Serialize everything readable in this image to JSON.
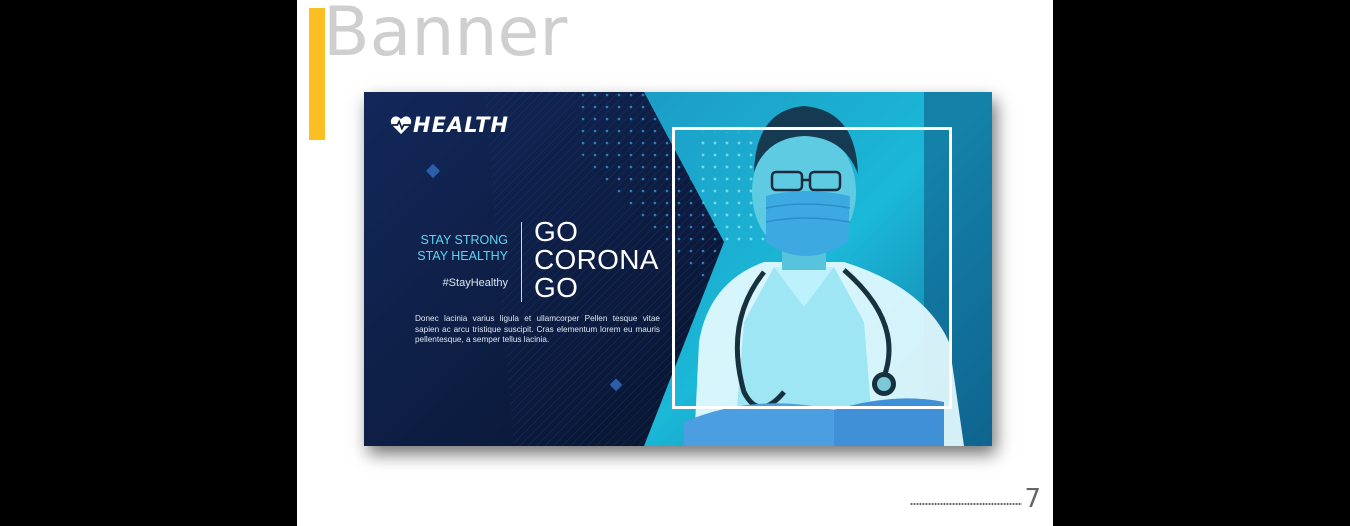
{
  "page": {
    "title": "Banner",
    "number": "7",
    "accent_color": "#fbbf24"
  },
  "banner": {
    "brand": {
      "icon": "heart-pulse-icon",
      "name": "HEALTH"
    },
    "slogan": [
      "STAY STRONG",
      "STAY HEALTHY"
    ],
    "hashtag": "#StayHealthy",
    "headline": [
      "GO",
      "CORONA",
      "GO"
    ],
    "body": "Donec lacinia varius ligula et ullamcorper Pellen tesque vitae sapien ac arcu tristique suscipit. Cras elementum lorem eu mauris pellentesque, a semper tellus lacinia.",
    "colors": {
      "navy": "#0b1a3e",
      "cyan": "#1bb8d8",
      "highlight": "#5fd4f0"
    },
    "photo": "doctor-with-mask-illustration"
  }
}
